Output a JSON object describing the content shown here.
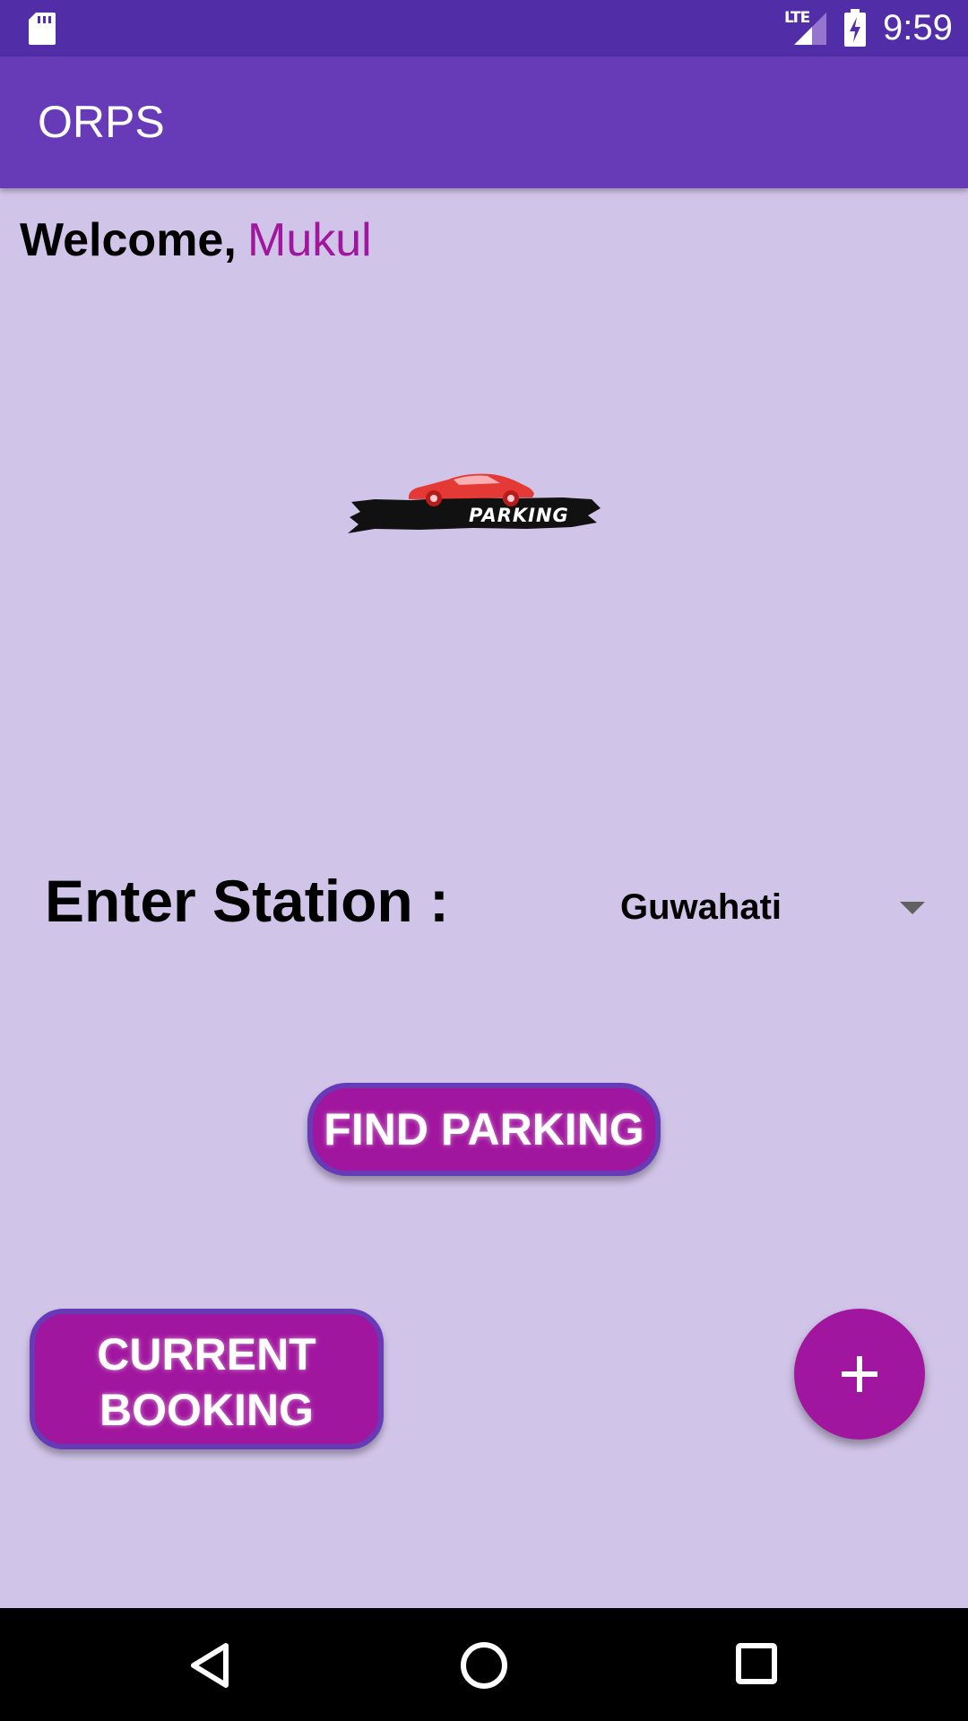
{
  "status_bar": {
    "network_label": "LTE",
    "time": "9:59",
    "icons": [
      "sd-card-icon",
      "signal-icon",
      "battery-charging-icon"
    ]
  },
  "app_bar": {
    "title": "ORPS"
  },
  "welcome": {
    "label": "Welcome,",
    "user_name": "Mukul"
  },
  "logo": {
    "text": "PARKING",
    "icon": "car-icon"
  },
  "station": {
    "label": "Enter Station :",
    "selected": "Guwahati"
  },
  "buttons": {
    "find_parking": "FIND PARKING",
    "current_booking_line1": "CURRENT",
    "current_booking_line2": "BOOKING",
    "fab_icon": "plus-icon"
  },
  "nav_bar": {
    "icons": [
      "back-icon",
      "home-icon",
      "recents-icon"
    ]
  },
  "colors": {
    "status_bar": "#512da8",
    "app_bar": "#673ab7",
    "background": "#d1c4e9",
    "accent": "#a1169e",
    "button_border": "#673ab7"
  }
}
